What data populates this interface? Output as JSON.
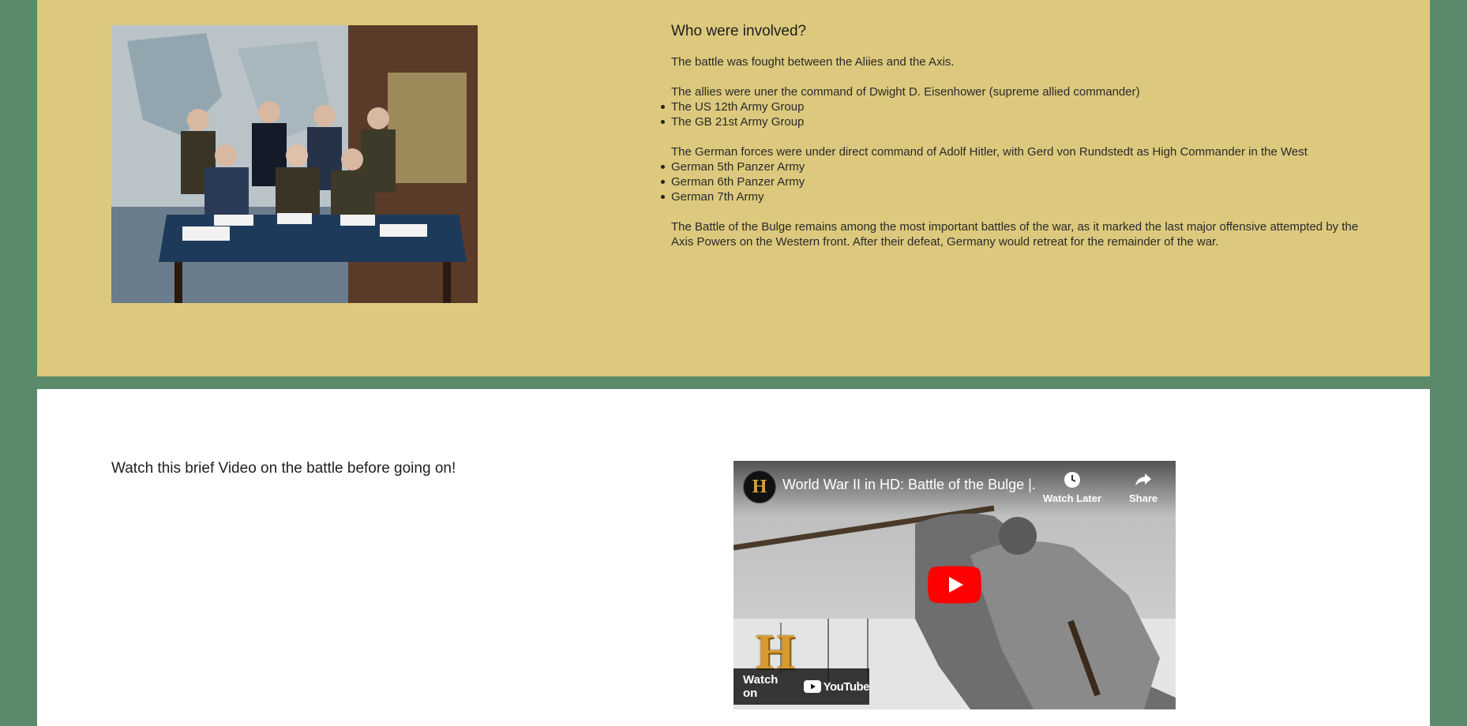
{
  "involved": {
    "heading": "Who were involved?",
    "intro": "The battle was fought between the Aliies and the Axis.",
    "allies_intro": "The allies were uner the command of Dwight D. Eisenhower (supreme allied commander)",
    "allies_list": [
      "The US 12th Army Group",
      "The GB 21st Army Group"
    ],
    "axis_intro": "The German forces were under direct command of Adolf Hitler, with Gerd von Rundstedt as High Commander in the West",
    "axis_list": [
      "German 5th Panzer Army",
      "German 6th Panzer Army",
      "German 7th Army"
    ],
    "conclusion": "The Battle of the Bulge remains among the most important battles of the war, as it marked the last major offensive attempted by the Axis Powers on the Western front. After their defeat, Germany would retreat for the remainder of the war."
  },
  "video_section": {
    "prompt": "Watch this brief Video on the battle before going on!",
    "video": {
      "channel_logo_letter": "H",
      "title": "World War II in HD: Battle of the Bulge |...",
      "watch_later_label": "Watch Later",
      "share_label": "Share",
      "watch_on_label": "Watch on",
      "youtube_label": "YouTube",
      "overlay_logo_letter": "H"
    }
  },
  "colors": {
    "page_background": "#5a8a6a",
    "yellow_panel": "#dcc97d",
    "white_panel": "#ffffff",
    "play_button_red": "#ff0000"
  }
}
